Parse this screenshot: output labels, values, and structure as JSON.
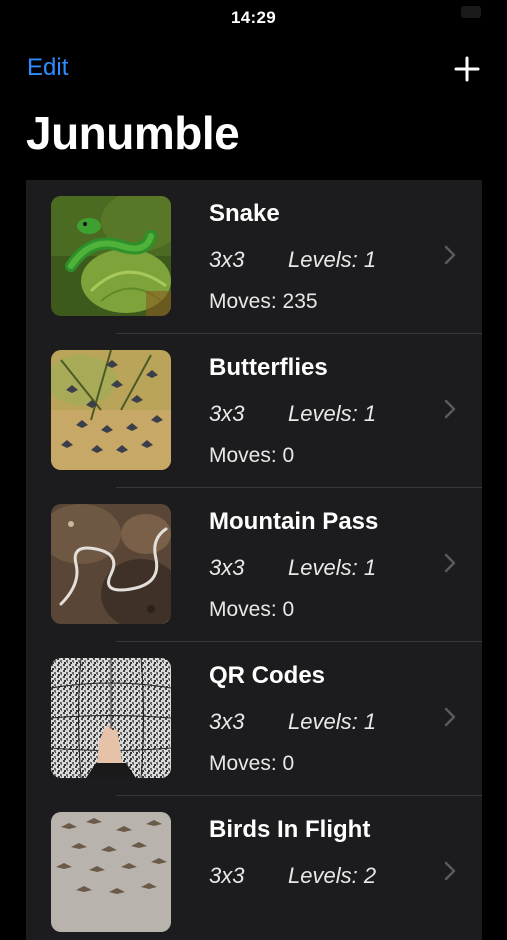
{
  "status_bar": {
    "time": "14:29"
  },
  "nav": {
    "edit_label": "Edit",
    "add_icon": "plus-icon"
  },
  "title": "Junumble",
  "colors": {
    "accent": "#2f8cff",
    "background": "#000000",
    "list_background": "#1c1c1e"
  },
  "items": [
    {
      "title": "Snake",
      "size": "3x3",
      "levels": "Levels: 1",
      "moves": "Moves: 235",
      "thumbnail": "snake-photo"
    },
    {
      "title": "Butterflies",
      "size": "3x3",
      "levels": "Levels: 1",
      "moves": "Moves: 0",
      "thumbnail": "butterflies-photo"
    },
    {
      "title": "Mountain Pass",
      "size": "3x3",
      "levels": "Levels: 1",
      "moves": "Moves: 0",
      "thumbnail": "mountain-pass-photo"
    },
    {
      "title": "QR Codes",
      "size": "3x3",
      "levels": "Levels: 1",
      "moves": "Moves: 0",
      "thumbnail": "qr-codes-photo"
    },
    {
      "title": "Birds In Flight",
      "size": "3x3",
      "levels": "Levels: 2",
      "moves": "",
      "thumbnail": "birds-in-flight-photo"
    }
  ]
}
